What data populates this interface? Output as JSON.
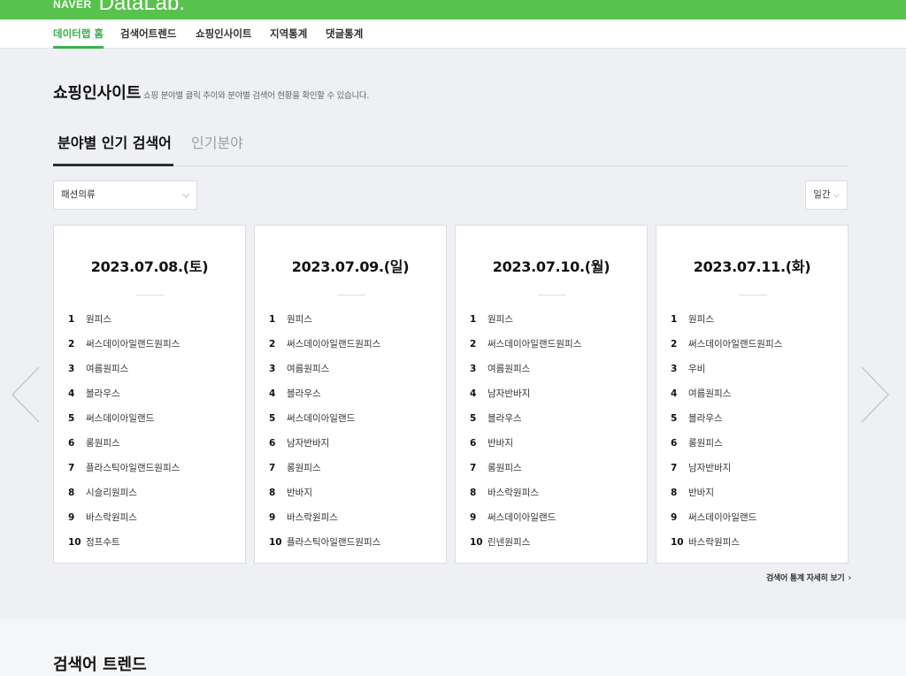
{
  "header": {
    "brand_naver": "NAVER",
    "brand_datalab": "DataLab."
  },
  "nav": [
    {
      "label": "데이터랩 홈"
    },
    {
      "label": "검색어트렌드"
    },
    {
      "label": "쇼핑인사이트"
    },
    {
      "label": "지역통계"
    },
    {
      "label": "댓글통계"
    }
  ],
  "section": {
    "title": "쇼핑인사이트",
    "description": "쇼핑 분야별 클릭 추이와 분야별 검색어 현황을 확인할 수 있습니다."
  },
  "tabs": [
    {
      "label": "분야별 인기 검색어"
    },
    {
      "label": "인기분야"
    }
  ],
  "filters": {
    "category": "패션의류",
    "period": "일간"
  },
  "cards": [
    {
      "date": "2023.07.08.(토)",
      "items": [
        {
          "rank": "1",
          "keyword": "원피스"
        },
        {
          "rank": "2",
          "keyword": "써스데이아일랜드원피스"
        },
        {
          "rank": "3",
          "keyword": "여름원피스"
        },
        {
          "rank": "4",
          "keyword": "블라우스"
        },
        {
          "rank": "5",
          "keyword": "써스데이아일랜드"
        },
        {
          "rank": "6",
          "keyword": "롱원피스"
        },
        {
          "rank": "7",
          "keyword": "플라스틱아일랜드원피스"
        },
        {
          "rank": "8",
          "keyword": "시슬리원피스"
        },
        {
          "rank": "9",
          "keyword": "바스락원피스"
        },
        {
          "rank": "10",
          "keyword": "점프수트"
        }
      ]
    },
    {
      "date": "2023.07.09.(일)",
      "items": [
        {
          "rank": "1",
          "keyword": "원피스"
        },
        {
          "rank": "2",
          "keyword": "써스데이아일랜드원피스"
        },
        {
          "rank": "3",
          "keyword": "여름원피스"
        },
        {
          "rank": "4",
          "keyword": "블라우스"
        },
        {
          "rank": "5",
          "keyword": "써스데이아일랜드"
        },
        {
          "rank": "6",
          "keyword": "남자반바지"
        },
        {
          "rank": "7",
          "keyword": "롱원피스"
        },
        {
          "rank": "8",
          "keyword": "반바지"
        },
        {
          "rank": "9",
          "keyword": "바스락원피스"
        },
        {
          "rank": "10",
          "keyword": "플라스틱아일랜드원피스"
        }
      ]
    },
    {
      "date": "2023.07.10.(월)",
      "items": [
        {
          "rank": "1",
          "keyword": "원피스"
        },
        {
          "rank": "2",
          "keyword": "써스데이아일랜드원피스"
        },
        {
          "rank": "3",
          "keyword": "여름원피스"
        },
        {
          "rank": "4",
          "keyword": "남자반바지"
        },
        {
          "rank": "5",
          "keyword": "블라우스"
        },
        {
          "rank": "6",
          "keyword": "반바지"
        },
        {
          "rank": "7",
          "keyword": "롱원피스"
        },
        {
          "rank": "8",
          "keyword": "바스락원피스"
        },
        {
          "rank": "9",
          "keyword": "써스데이아일랜드"
        },
        {
          "rank": "10",
          "keyword": "린넨원피스"
        }
      ]
    },
    {
      "date": "2023.07.11.(화)",
      "items": [
        {
          "rank": "1",
          "keyword": "원피스"
        },
        {
          "rank": "2",
          "keyword": "써스데이아일랜드원피스"
        },
        {
          "rank": "3",
          "keyword": "우비"
        },
        {
          "rank": "4",
          "keyword": "여름원피스"
        },
        {
          "rank": "5",
          "keyword": "블라우스"
        },
        {
          "rank": "6",
          "keyword": "롱원피스"
        },
        {
          "rank": "7",
          "keyword": "남자반바지"
        },
        {
          "rank": "8",
          "keyword": "반바지"
        },
        {
          "rank": "9",
          "keyword": "써스데이아일랜드"
        },
        {
          "rank": "10",
          "keyword": "바스락원피스"
        }
      ]
    }
  ],
  "more_link": "검색어 통계 자세히 보기",
  "next_section": {
    "title": "검색어 트렌드"
  },
  "colors": {
    "brand_green": "#57c24c",
    "nav_active": "#36b34a",
    "background": "#eef0f4"
  },
  "icons": {
    "select_chevron": "chevron-down-icon",
    "prev": "chevron-left-icon",
    "next": "chevron-right-icon",
    "more": "chevron-right-icon"
  }
}
